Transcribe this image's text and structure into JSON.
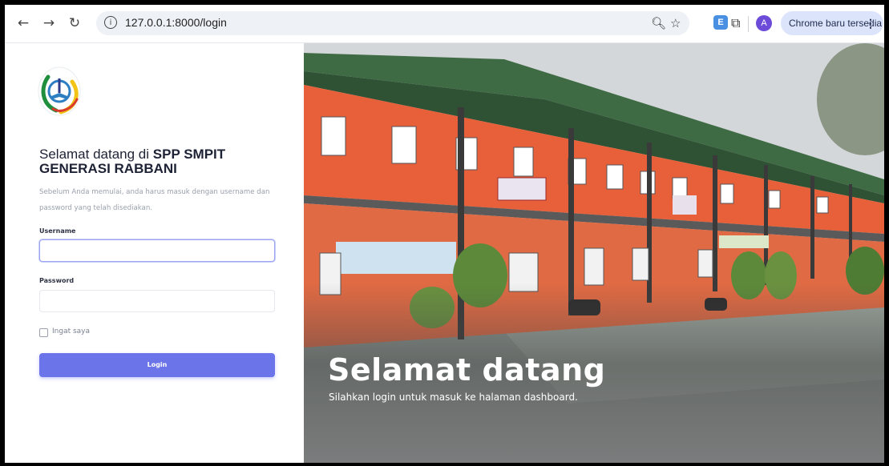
{
  "browser": {
    "url": "127.0.0.1:8000/login",
    "update_label": "Chrome baru tersedia",
    "profile_initial": "A",
    "extension_label": "E"
  },
  "login": {
    "heading_prefix": "Selamat datang di",
    "heading_brand": "SPP SMPIT GENERASI RABBANI",
    "intro": "Sebelum Anda memulai, anda harus masuk dengan username dan password yang telah disediakan.",
    "username_label": "Username",
    "username_value": "",
    "password_label": "Password",
    "password_value": "",
    "remember_label": "Ingat saya",
    "submit_label": "Login",
    "accent_color": "#6b74e8"
  },
  "hero": {
    "title": "Selamat datang",
    "subtitle": "Silahkan login untuk masuk ke halaman dashboard."
  }
}
